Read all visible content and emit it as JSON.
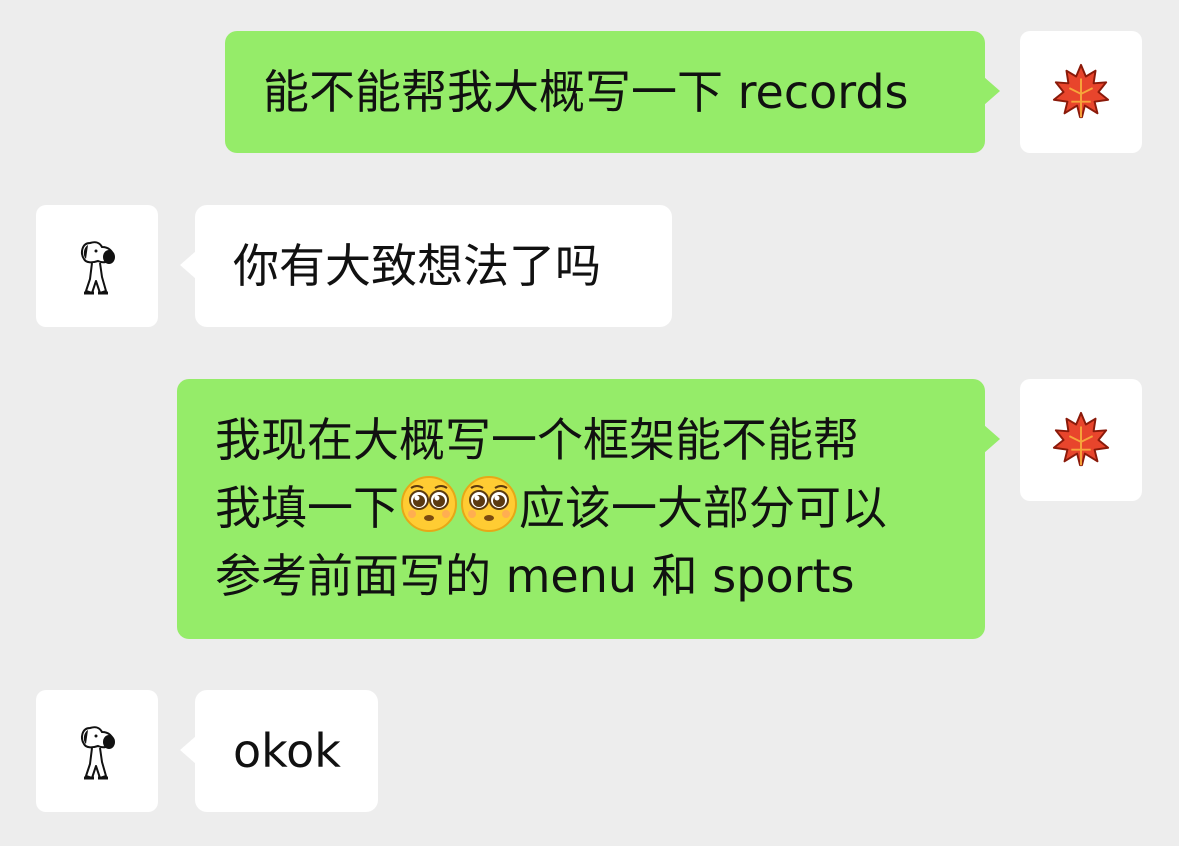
{
  "messages": [
    {
      "direction": "sent",
      "lines": [
        "能不能帮我大概写一下 records"
      ]
    },
    {
      "direction": "received",
      "lines": [
        "你有大致想法了吗"
      ]
    },
    {
      "direction": "sent",
      "lines": [
        "我现在大概写一个框架能不能帮",
        "我填一下",
        "应该一大部分可以",
        "参考前面写的 menu 和 sports"
      ]
    },
    {
      "direction": "received",
      "lines": [
        "okok"
      ]
    }
  ],
  "emoji": [
    "pleading-face-emoji",
    "pleading-face-emoji"
  ],
  "avatars": {
    "self": "maple-leaf-icon",
    "other": "snoopy-icon"
  },
  "colors": {
    "background": "#ededed",
    "sent_bubble": "#95ec69",
    "received_bubble": "#ffffff",
    "text": "#111111"
  }
}
